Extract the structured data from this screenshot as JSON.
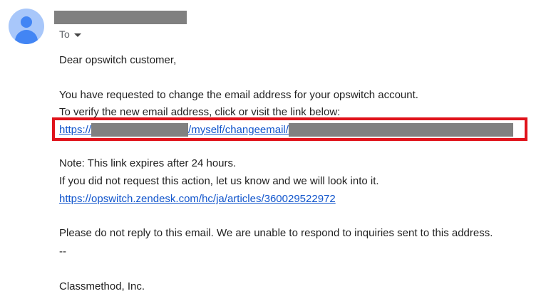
{
  "email": {
    "to_label": "To",
    "greeting": "Dear opswitch customer,",
    "para1_line1": "You have requested to change the email address for your opswitch account.",
    "para1_line2": "To verify the new email address, click or visit the link below:",
    "verify_link": {
      "prefix": "https://",
      "middle": "/myself/changeemail/"
    },
    "note_line": "Note: This link expires after 24 hours.",
    "if_line": "If you did not request this action, let us know and we will look into it.",
    "help_link": "https://opswitch.zendesk.com/hc/ja/articles/360029522972",
    "noreply_line": "Please do not reply to this email. We are unable to respond to inquiries sent to this address.",
    "signature_sep": "--",
    "company": "Classmethod, Inc."
  },
  "colors": {
    "link": "#1155cc",
    "highlight_box": "#e0131b",
    "redaction": "#808080",
    "avatar_bg": "#a8c7fa",
    "avatar_fg": "#4285f4"
  },
  "icons": {
    "avatar": "person-avatar-icon",
    "recipients_toggle": "caret-down-icon"
  }
}
